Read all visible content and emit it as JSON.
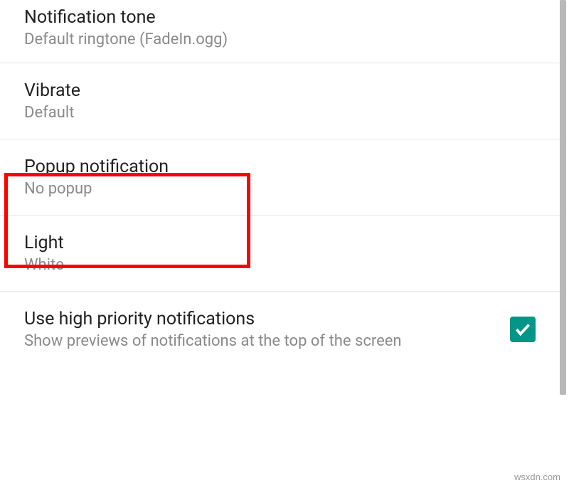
{
  "items": {
    "notification_tone": {
      "title": "Notification tone",
      "subtitle": "Default ringtone (FadeIn.ogg)"
    },
    "vibrate": {
      "title": "Vibrate",
      "subtitle": "Default"
    },
    "popup": {
      "title": "Popup notification",
      "subtitle": "No popup"
    },
    "light": {
      "title": "Light",
      "subtitle": "White"
    },
    "high_priority": {
      "title": "Use high priority notifications",
      "subtitle": "Show previews of notifications at the top of the screen",
      "checked": true
    }
  },
  "watermark": "wsxdn.com",
  "colors": {
    "accent": "#009688",
    "highlight": "#ff0000"
  }
}
